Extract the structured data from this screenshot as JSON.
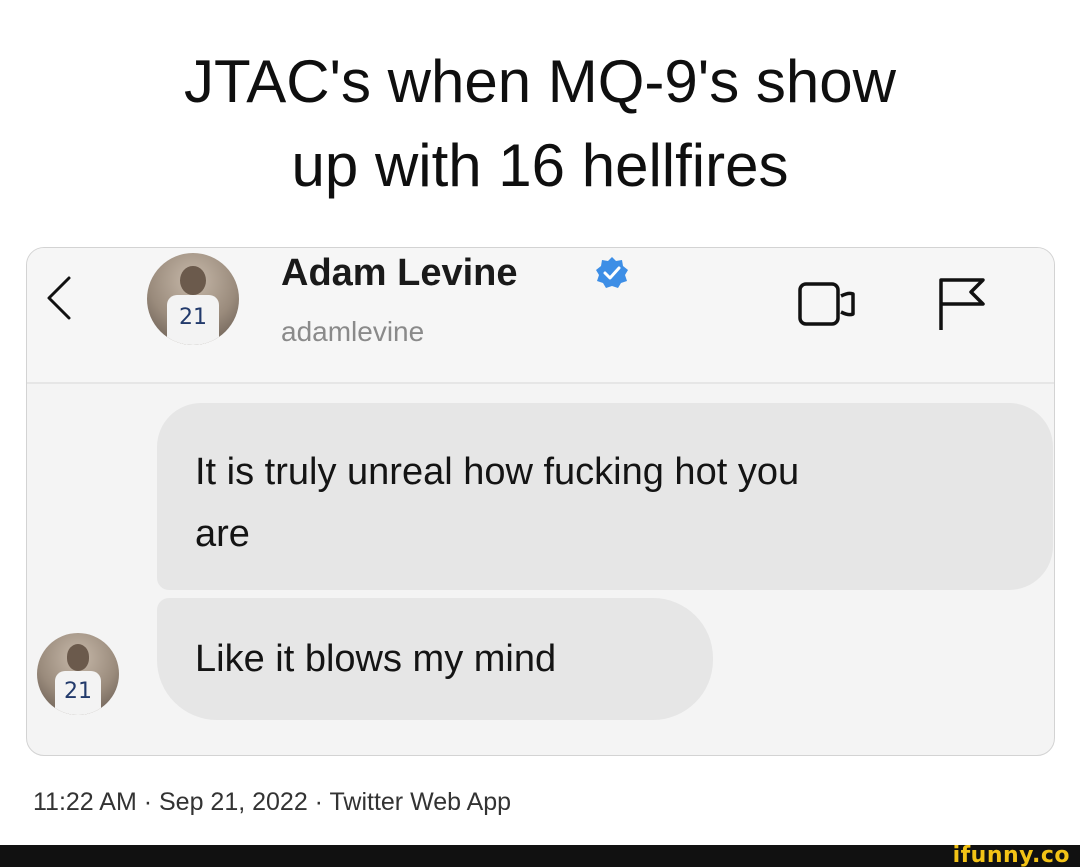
{
  "caption": {
    "line1": "JTAC's when MQ-9's show",
    "line2": "up with 16 hellfires"
  },
  "dm": {
    "contact": {
      "display_name": "Adam Levine",
      "username": "adamlevine",
      "jersey_number": "21"
    },
    "messages": [
      {
        "text_line1": "It is truly unreal how fucking hot you",
        "text_line2": "are"
      },
      {
        "text": "Like it blows my mind"
      }
    ],
    "icons": {
      "back": "chevron-left-icon",
      "verified": "verified-badge-icon",
      "video": "video-call-icon",
      "flag": "flag-icon"
    },
    "colors": {
      "verified_blue": "#3d8ee6",
      "bubble": "#e6e6e6",
      "panel": "#f4f4f4"
    }
  },
  "tweet_meta": {
    "timestamp": "11:22 AM · Sep 21, 2022 · Twitter Web App"
  },
  "footer": {
    "watermark": "ifunny.co",
    "colors": {
      "bar": "#111111",
      "logo": "#f3c316"
    }
  }
}
